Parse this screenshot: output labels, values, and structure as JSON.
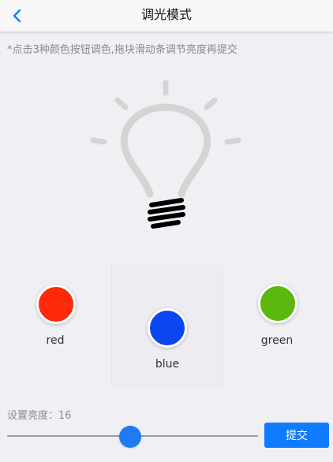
{
  "header": {
    "title": "调光模式"
  },
  "hint_text": "*点击3种颜色按钮调色,拖块滑动条调节亮度再提交",
  "colors": [
    {
      "label": "red",
      "color": "#ff2a0a"
    },
    {
      "label": "blue",
      "color": "#0b46f0"
    },
    {
      "label": "green",
      "color": "#5ab80e"
    }
  ],
  "brightness": {
    "label_prefix": "设置亮度：",
    "value": 16,
    "label": "设置亮度：16",
    "slider_fraction": 0.49
  },
  "submit_label": "提交",
  "accent_color": "#0f7cff",
  "icons": {
    "back": "chevron-left-icon",
    "bulb": "lightbulb-icon"
  }
}
